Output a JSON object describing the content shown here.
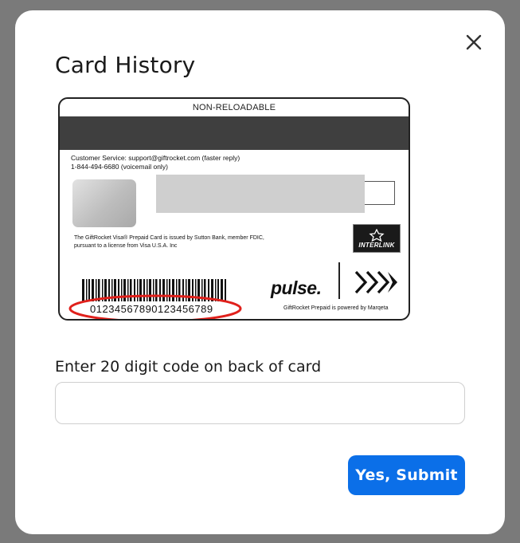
{
  "modal": {
    "title": "Card History",
    "close_icon": "close-icon"
  },
  "card": {
    "top_label": "NON-RELOADABLE",
    "customer_service_line1": "Customer Service: support@giftrocket.com (faster reply)",
    "customer_service_line2": "1-844-494-6680 (voicemail only)",
    "issuer_line1": "The GiftRocket Visa® Prepaid Card is issued by Sutton Bank, member FDIC,",
    "issuer_line2": "pursuant to a license from Visa U.S.A. Inc",
    "interlink_label": "INTERLINK",
    "card_number": "01234567890123456789",
    "pulse_label": "pulse.",
    "powered_by": "GiftRocket Prepaid is powered by Marqeta",
    "highlight_color": "#e0201b"
  },
  "form": {
    "input_label": "Enter 20 digit code on back of card",
    "input_value": "",
    "input_placeholder": "",
    "submit_label": "Yes, Submit"
  },
  "colors": {
    "overlay": "#7a7a7a",
    "primary_button": "#0b6fe8"
  }
}
